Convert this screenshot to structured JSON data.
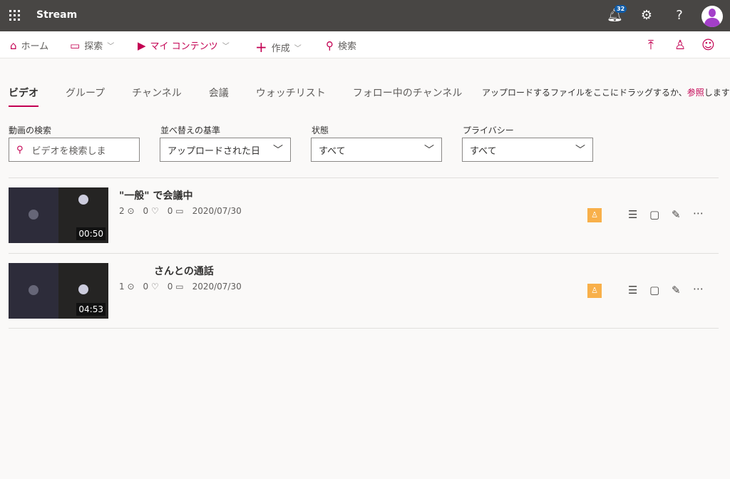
{
  "app": {
    "title": "Stream",
    "notifications": "32"
  },
  "nav": {
    "home": "ホーム",
    "explore": "探索",
    "my_content": "マイ コンテンツ",
    "create": "作成",
    "search": "検索"
  },
  "tabs": [
    "ビデオ",
    "グループ",
    "チャンネル",
    "会議",
    "ウォッチリスト",
    "フォロー中のチャンネル"
  ],
  "upload": {
    "text": "アップロードするファイルをここにドラッグするか、",
    "link": "参照",
    "suffix": "します"
  },
  "filters": {
    "search_label": "動画の検索",
    "search_placeholder": "ビデオを検索しま",
    "sort_label": "並べ替えの基準",
    "sort_value": "アップロードされた日",
    "status_label": "状態",
    "status_value": "すべて",
    "privacy_label": "プライバシー",
    "privacy_value": "すべて"
  },
  "videos": [
    {
      "title": "\"一般\" で会議中",
      "views": "2",
      "likes": "0",
      "comments": "0",
      "date": "2020/07/30",
      "duration": "00:50"
    },
    {
      "title": "さんとの通話",
      "views": "1",
      "likes": "0",
      "comments": "0",
      "date": "2020/07/30",
      "duration": "04:53"
    }
  ],
  "colors": {
    "accent": "#c30052",
    "topbar": "#484644",
    "permission": "#f8b04a"
  }
}
